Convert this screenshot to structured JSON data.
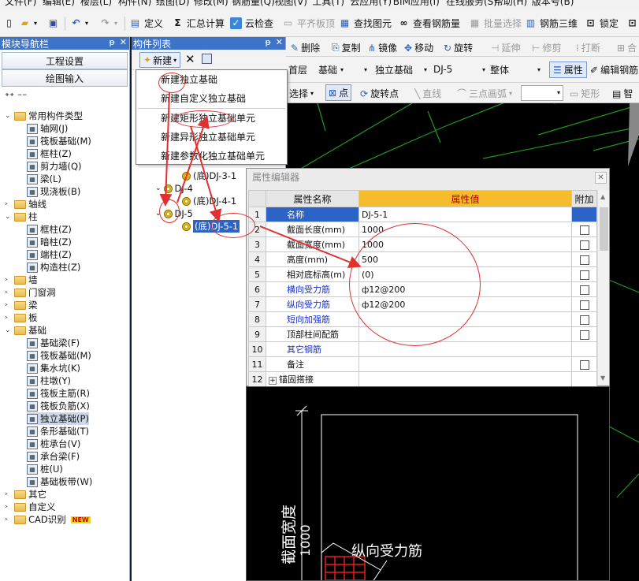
{
  "menu": [
    "文件(F)",
    "编辑(E)",
    "楼层(L)",
    "构件(N)",
    "绘图(D)",
    "修改(M)",
    "钢筋量(Q)",
    "视图(V)",
    "工具(T)",
    "云应用(Y)",
    "BIM应用(I)",
    "在线服务(S)",
    "帮助(H)",
    "版本号(B)"
  ],
  "toolbar": {
    "define": "定义",
    "sum": "汇总计算",
    "cloud_check": "云检查",
    "flat_top": "平齐板顶",
    "find": "查找图元",
    "view_rebar": "查看钢筋量",
    "batch_select": "批量选择",
    "rebar_3d": "钢筋三维",
    "lock": "锁定"
  },
  "nav": {
    "title": "模块导航栏",
    "project_settings": "工程设置",
    "drawing_input": "绘图输入",
    "tree": [
      {
        "label": "常用构件类型",
        "level": 0,
        "type": "folder",
        "expanded": true
      },
      {
        "label": "轴网(J)",
        "level": 1,
        "type": "item"
      },
      {
        "label": "筏板基础(M)",
        "level": 1,
        "type": "item"
      },
      {
        "label": "框柱(Z)",
        "level": 1,
        "type": "item"
      },
      {
        "label": "剪力墙(Q)",
        "level": 1,
        "type": "item"
      },
      {
        "label": "梁(L)",
        "level": 1,
        "type": "item"
      },
      {
        "label": "现浇板(B)",
        "level": 1,
        "type": "item"
      },
      {
        "label": "轴线",
        "level": 0,
        "type": "folder",
        "expanded": false
      },
      {
        "label": "柱",
        "level": 0,
        "type": "folder",
        "expanded": true
      },
      {
        "label": "框柱(Z)",
        "level": 1,
        "type": "item"
      },
      {
        "label": "暗柱(Z)",
        "level": 1,
        "type": "item"
      },
      {
        "label": "端柱(Z)",
        "level": 1,
        "type": "item"
      },
      {
        "label": "构造柱(Z)",
        "level": 1,
        "type": "item"
      },
      {
        "label": "墙",
        "level": 0,
        "type": "folder",
        "expanded": false
      },
      {
        "label": "门窗洞",
        "level": 0,
        "type": "folder",
        "expanded": false
      },
      {
        "label": "梁",
        "level": 0,
        "type": "folder",
        "expanded": false
      },
      {
        "label": "板",
        "level": 0,
        "type": "folder",
        "expanded": false
      },
      {
        "label": "基础",
        "level": 0,
        "type": "folder",
        "expanded": true
      },
      {
        "label": "基础梁(F)",
        "level": 1,
        "type": "item"
      },
      {
        "label": "筏板基础(M)",
        "level": 1,
        "type": "item"
      },
      {
        "label": "集水坑(K)",
        "level": 1,
        "type": "item"
      },
      {
        "label": "柱墩(Y)",
        "level": 1,
        "type": "item"
      },
      {
        "label": "筏板主筋(R)",
        "level": 1,
        "type": "item"
      },
      {
        "label": "筏板负筋(X)",
        "level": 1,
        "type": "item"
      },
      {
        "label": "独立基础(P)",
        "level": 1,
        "type": "item",
        "selected": true
      },
      {
        "label": "条形基础(T)",
        "level": 1,
        "type": "item"
      },
      {
        "label": "桩承台(V)",
        "level": 1,
        "type": "item"
      },
      {
        "label": "承台梁(F)",
        "level": 1,
        "type": "item"
      },
      {
        "label": "桩(U)",
        "level": 1,
        "type": "item"
      },
      {
        "label": "基础板带(W)",
        "level": 1,
        "type": "item"
      },
      {
        "label": "其它",
        "level": 0,
        "type": "folder",
        "expanded": false
      },
      {
        "label": "自定义",
        "level": 0,
        "type": "folder",
        "expanded": false
      },
      {
        "label": "CAD识别",
        "level": 0,
        "type": "folder",
        "expanded": false,
        "badge": "NEW"
      }
    ]
  },
  "component_list": {
    "title": "构件列表",
    "new_label": "新建",
    "menu": [
      "新建独立基础",
      "新建自定义独立基础",
      "新建矩形独立基础单元",
      "新建异形独立基础单元",
      "新建参数化独立基础单元"
    ],
    "tree": [
      {
        "label": "(底)DJ-3-1",
        "level": 1
      },
      {
        "label": "DJ-4",
        "level": 0
      },
      {
        "label": "(底)DJ-4-1",
        "level": 1
      },
      {
        "label": "DJ-5",
        "level": 0
      },
      {
        "label": "(底)DJ-5-1",
        "level": 1,
        "selected": true
      }
    ]
  },
  "edit_toolbar": {
    "delete": "删除",
    "copy": "复制",
    "mirror": "镜像",
    "move": "移动",
    "rotate": "旋转",
    "extend": "延伸",
    "trim": "修剪",
    "break": "打断",
    "merge": "合"
  },
  "selectors": {
    "floor": "首层",
    "category": "基础",
    "type": "独立基础",
    "component": "DJ-5",
    "part": "整体",
    "property": "属性",
    "edit_rebar": "编辑钢筋"
  },
  "draw_toolbar": {
    "select": "选择",
    "point": "点",
    "rotate_point": "旋转点",
    "line": "直线",
    "arc": "三点画弧",
    "rect": "矩形",
    "smart": "智"
  },
  "property_editor": {
    "title": "属性编辑器",
    "headers": {
      "name": "属性名称",
      "value": "属性值",
      "extra": "附加"
    },
    "rows": [
      {
        "n": "1",
        "name": "名称",
        "value": "DJ-5-1",
        "blue": true,
        "check": false
      },
      {
        "n": "2",
        "name": "截面长度(mm)",
        "value": "1000",
        "blue": false,
        "check": true
      },
      {
        "n": "3",
        "name": "截面宽度(mm)",
        "value": "1000",
        "blue": false,
        "check": true
      },
      {
        "n": "4",
        "name": "高度(mm)",
        "value": "500",
        "blue": false,
        "check": true
      },
      {
        "n": "5",
        "name": "相对底标高(m)",
        "value": "(0)",
        "blue": false,
        "check": true
      },
      {
        "n": "6",
        "name": "横向受力筋",
        "value": "ф12@200",
        "blue": true,
        "check": true
      },
      {
        "n": "7",
        "name": "纵向受力筋",
        "value": "ф12@200",
        "blue": true,
        "check": true
      },
      {
        "n": "8",
        "name": "短向加强筋",
        "value": "",
        "blue": true,
        "check": true
      },
      {
        "n": "9",
        "name": "顶部柱间配筋",
        "value": "",
        "blue": false,
        "check": true
      },
      {
        "n": "10",
        "name": "其它钢筋",
        "value": "",
        "blue": true,
        "check": false
      },
      {
        "n": "11",
        "name": "备注",
        "value": "",
        "blue": false,
        "check": true
      },
      {
        "n": "12",
        "name": "锚固搭接",
        "value": "",
        "blue": false,
        "check": false,
        "expand": true
      }
    ]
  },
  "preview": {
    "width_label": "截面宽度",
    "width_value": "1000",
    "rebar_label": "纵向受力筋"
  },
  "colors": {
    "title_bar": "#3d73c9",
    "header_value": "#f5bd2b",
    "selection": "#2b63c7",
    "annotation": "#e03030"
  }
}
